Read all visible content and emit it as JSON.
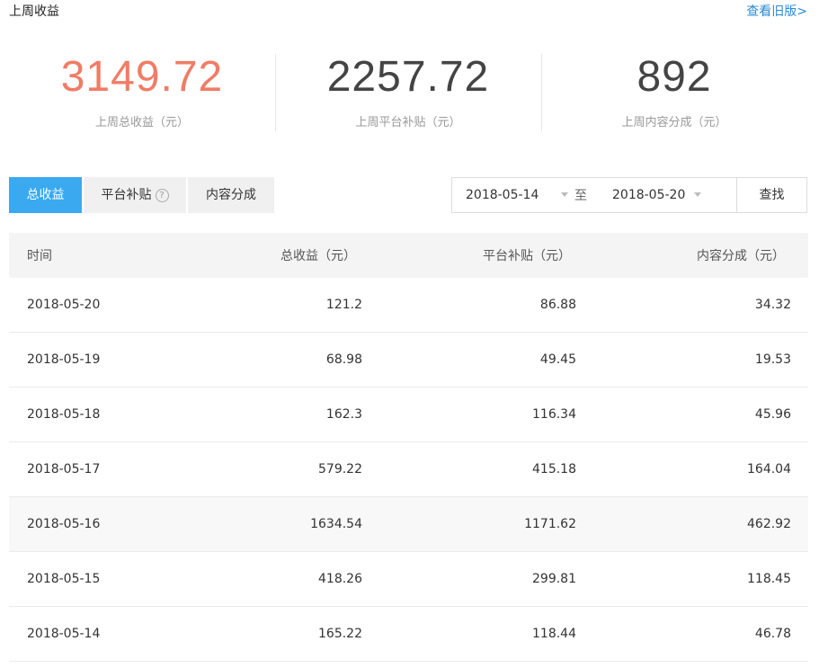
{
  "header": {
    "title": "上周收益",
    "old_version_link": "查看旧版>"
  },
  "stats": [
    {
      "value": "3149.72",
      "label": "上周总收益（元）"
    },
    {
      "value": "2257.72",
      "label": "上周平台补贴（元）"
    },
    {
      "value": "892",
      "label": "上周内容分成（元）"
    }
  ],
  "colors": {
    "accent": "#3aa9f0",
    "highlight": "#f07c66",
    "link": "#2a8ad4"
  },
  "tabs": [
    {
      "label": "总收益",
      "active": true
    },
    {
      "label": "平台补贴",
      "help_icon": "?"
    },
    {
      "label": "内容分成"
    }
  ],
  "filter": {
    "start_date": "2018-05-14",
    "separator": "至",
    "end_date": "2018-05-20",
    "search_label": "查找"
  },
  "table": {
    "headers": [
      "时间",
      "总收益（元）",
      "平台补贴（元）",
      "内容分成（元）"
    ],
    "rows": [
      [
        "2018-05-20",
        "121.2",
        "86.88",
        "34.32"
      ],
      [
        "2018-05-19",
        "68.98",
        "49.45",
        "19.53"
      ],
      [
        "2018-05-18",
        "162.3",
        "116.34",
        "45.96"
      ],
      [
        "2018-05-17",
        "579.22",
        "415.18",
        "164.04"
      ],
      [
        "2018-05-16",
        "1634.54",
        "1171.62",
        "462.92"
      ],
      [
        "2018-05-15",
        "418.26",
        "299.81",
        "118.45"
      ],
      [
        "2018-05-14",
        "165.22",
        "118.44",
        "46.78"
      ]
    ]
  }
}
